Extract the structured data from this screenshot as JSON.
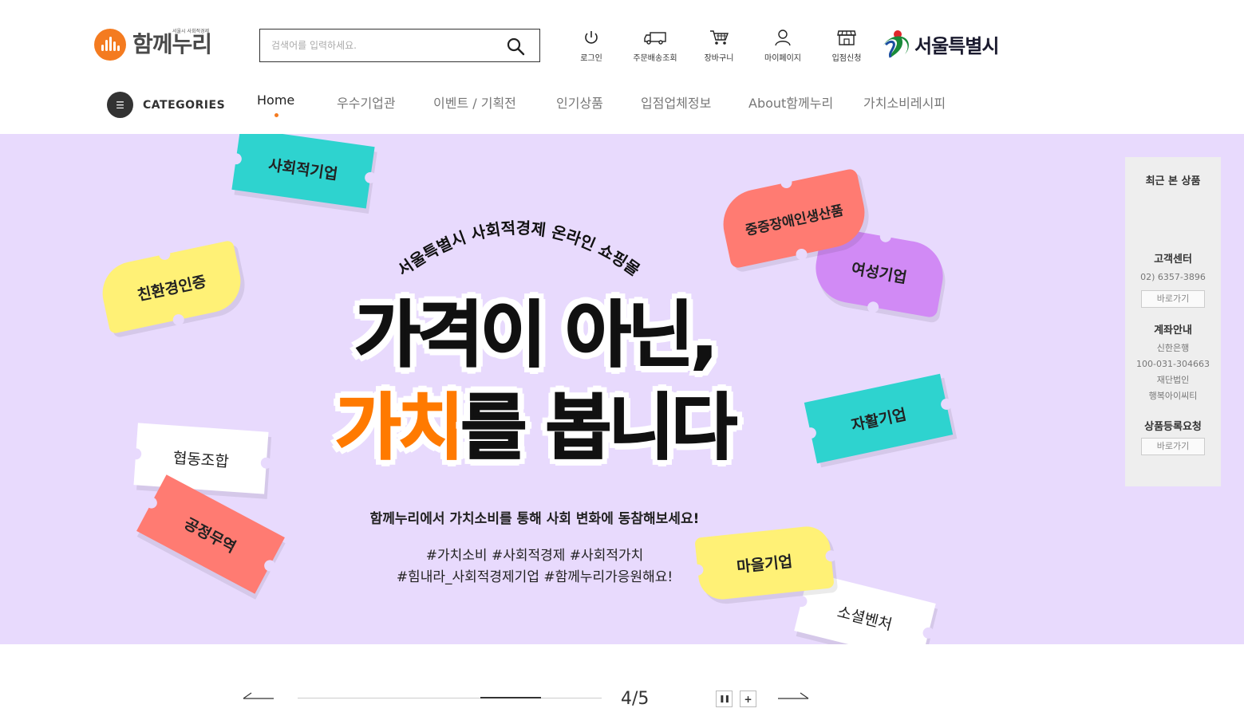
{
  "header": {
    "logo": {
      "sub": "서울시 사회적경제",
      "main": "함께누리"
    },
    "search": {
      "placeholder": "검색어를 입력하세요."
    },
    "utils": [
      {
        "icon": "power-icon",
        "label": "로그인"
      },
      {
        "icon": "truck-icon",
        "label": "주문배송조회"
      },
      {
        "icon": "cart-icon",
        "label": "장바구니"
      },
      {
        "icon": "user-icon",
        "label": "마이페이지"
      },
      {
        "icon": "store-icon",
        "label": "입점신청"
      }
    ],
    "partner": "서울특별시"
  },
  "nav": {
    "categories_label": "CATEGORIES",
    "items": [
      {
        "label": "Home",
        "active": true
      },
      {
        "label": "우수기업관"
      },
      {
        "label": "이벤트 / 기획전"
      },
      {
        "label": "인기상품"
      },
      {
        "label": "입점업체정보"
      },
      {
        "label": "About함께누리"
      },
      {
        "label": "가치소비레시피"
      }
    ]
  },
  "banner": {
    "background": "#e8dafd",
    "arc_title": "서울특별시 사회적경제 온라인 쇼핑몰",
    "line1": "가격이 아닌,",
    "line2_highlight": "가치",
    "line2_rest": "를 봅니다",
    "highlight_color": "#ff7a00",
    "subcopy": "함께누리에서 가치소비를 통해 사회 변화에 동참해보세요!",
    "tags_line1": "#가치소비 #사회적경제 #사회적가치",
    "tags_line2": "#힘내라_사회적경제기업 #함께누리가응원해요!",
    "tickets": [
      {
        "label": "사회적기업",
        "color": "#2ed3cf"
      },
      {
        "label": "친환경인증",
        "color": "#fff176"
      },
      {
        "label": "중증장애인생산품",
        "color": "#ff7b72"
      },
      {
        "label": "여성기업",
        "color": "#d18af5"
      },
      {
        "label": "자활기업",
        "color": "#2ed3cf"
      },
      {
        "label": "협동조합",
        "color": "#ffffff"
      },
      {
        "label": "공정무역",
        "color": "#ff7b72"
      },
      {
        "label": "마을기업",
        "color": "#fff176"
      },
      {
        "label": "소셜벤처",
        "color": "#ffffff"
      }
    ]
  },
  "side": {
    "recent_title": "최근 본 상품",
    "cs_title": "고객센터",
    "cs_phone": "02) 6357-3896",
    "cs_button": "바로가기",
    "account_title": "계좌안내",
    "account_bank": "신한은행",
    "account_number": "100-031-304663",
    "account_holder1": "재단법인",
    "account_holder2": "행복아이씨티",
    "register_title": "상품등록요청",
    "register_button": "바로가기"
  },
  "slider": {
    "counter": "4/5",
    "progress": 0.8,
    "pause_icon": "pause-icon",
    "play_icon": "plus-icon"
  }
}
